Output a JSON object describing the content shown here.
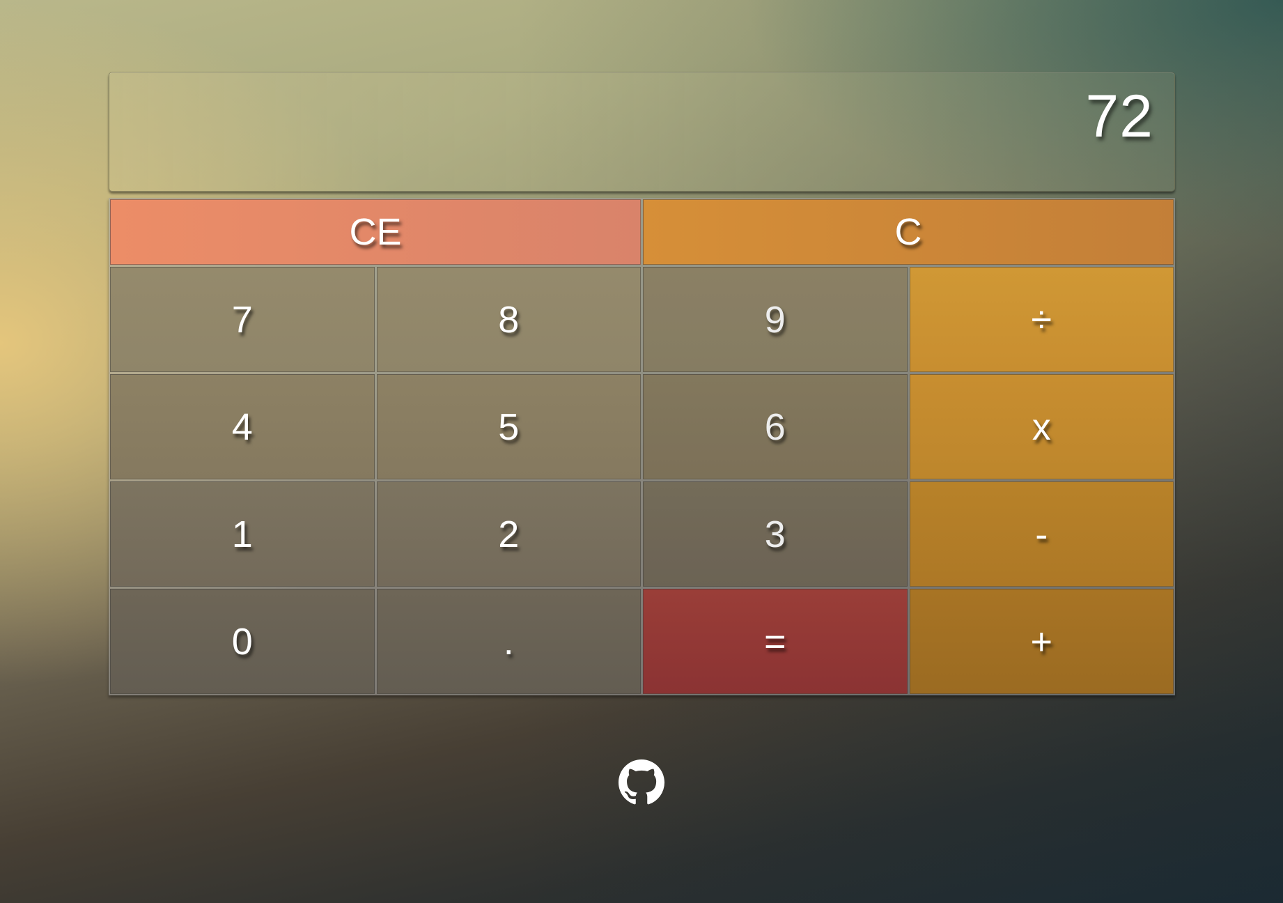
{
  "display": {
    "value": "72"
  },
  "keys": {
    "ce": "CE",
    "c": "C",
    "k7": "7",
    "k8": "8",
    "k9": "9",
    "divide": "÷",
    "k4": "4",
    "k5": "5",
    "k6": "6",
    "multiply": "x",
    "k1": "1",
    "k2": "2",
    "k3": "3",
    "minus": "-",
    "k0": "0",
    "dot": ".",
    "equals": "=",
    "plus": "+"
  },
  "footer": {
    "icon": "github-icon"
  },
  "colors": {
    "ce": "#E6896A",
    "clear": "#CD8A38",
    "operator": "#C08A2D",
    "equals": "#933A36",
    "number": "#8A7F66",
    "text": "#FFFFFF"
  }
}
